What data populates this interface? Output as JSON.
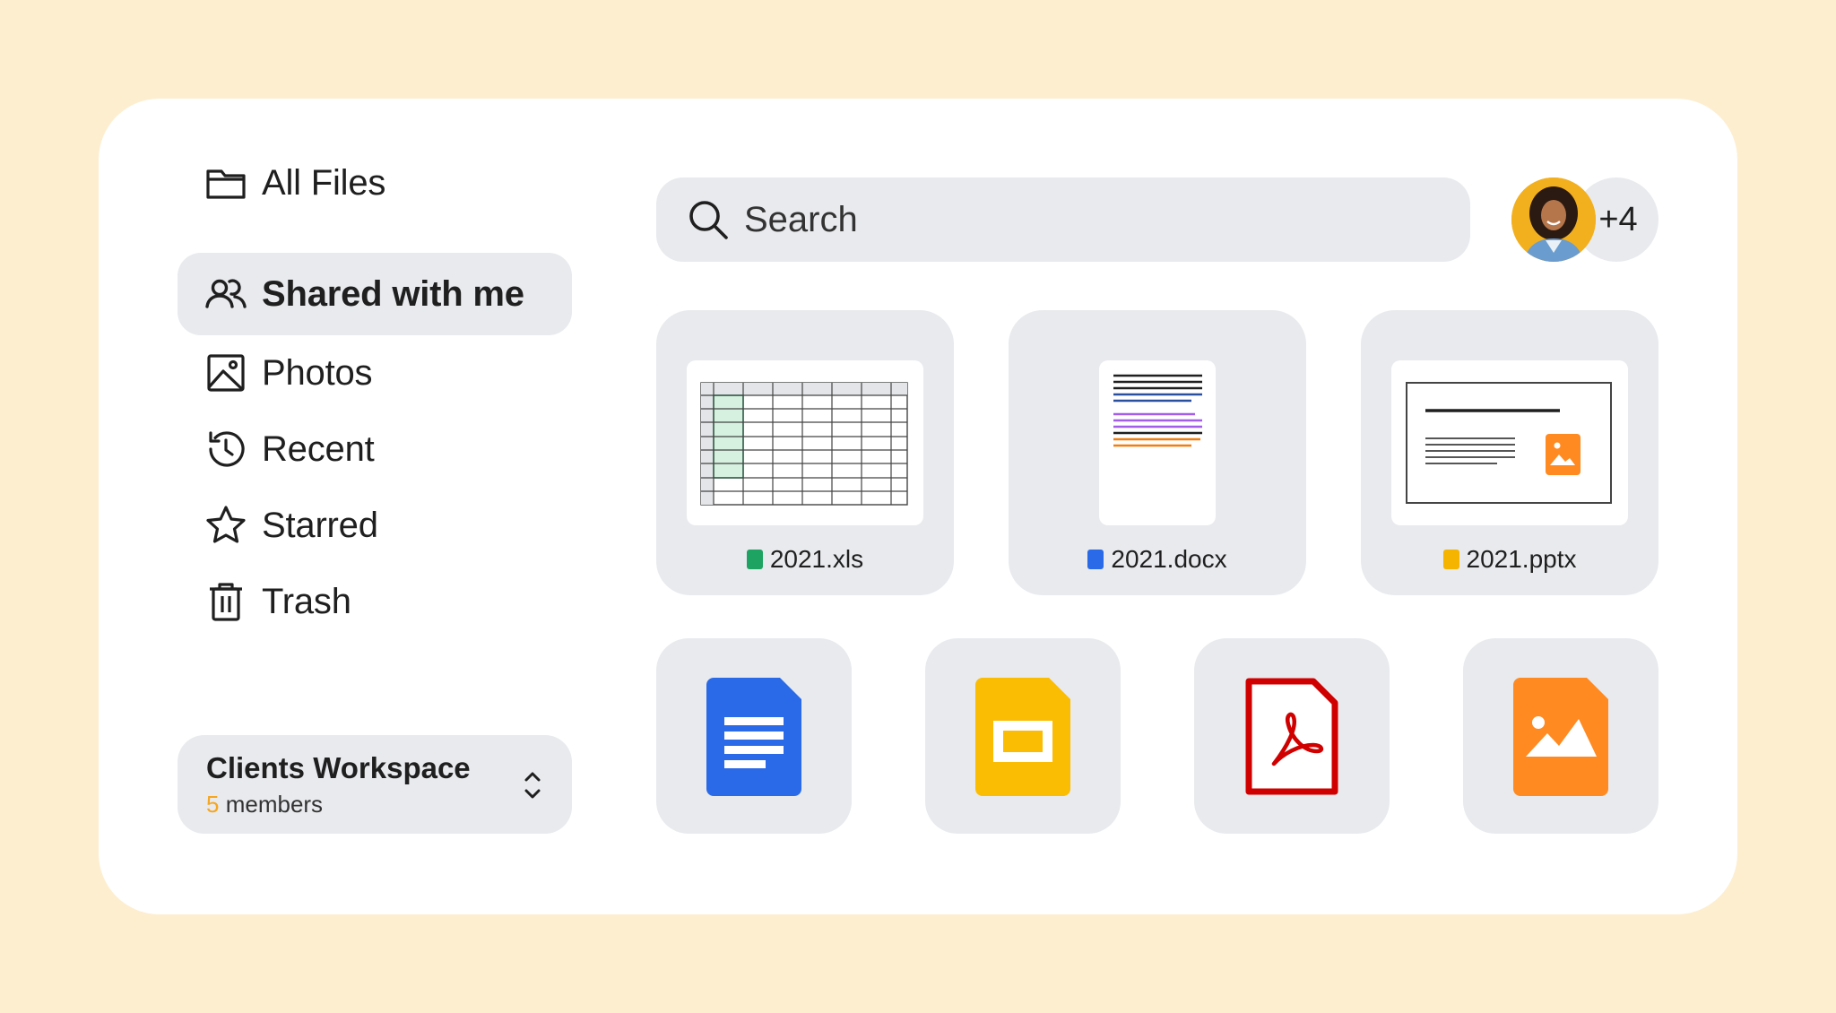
{
  "sidebar": {
    "items": [
      {
        "label": "All Files",
        "icon": "folder-icon",
        "active": false
      },
      {
        "label": "Shared with me",
        "icon": "people-icon",
        "active": true
      },
      {
        "label": "Photos",
        "icon": "image-icon",
        "active": false
      },
      {
        "label": "Recent",
        "icon": "history-icon",
        "active": false
      },
      {
        "label": "Starred",
        "icon": "star-icon",
        "active": false
      },
      {
        "label": "Trash",
        "icon": "trash-icon",
        "active": false
      }
    ],
    "workspace": {
      "name": "Clients Workspace",
      "member_count": "5",
      "member_label": "members"
    }
  },
  "search": {
    "placeholder": "Search"
  },
  "collaborators": {
    "extra_count": "+4"
  },
  "files": [
    {
      "name": "2021.xls",
      "type": "spreadsheet",
      "badge_color": "#1ea362"
    },
    {
      "name": "2021.docx",
      "type": "document",
      "badge_color": "#2a6ae8"
    },
    {
      "name": "2021.pptx",
      "type": "presentation",
      "badge_color": "#f5b400"
    }
  ],
  "file_types": [
    {
      "type": "docs",
      "icon": "google-docs-icon",
      "color": "#2a6ae8"
    },
    {
      "type": "slides",
      "icon": "google-slides-icon",
      "color": "#fbbc04"
    },
    {
      "type": "pdf",
      "icon": "pdf-icon",
      "color": "#d00000"
    },
    {
      "type": "image",
      "icon": "image-file-icon",
      "color": "#ff8a21"
    }
  ],
  "colors": {
    "background": "#fdeecf",
    "panel": "#ffffff",
    "surface": "#e8eaed",
    "accent": "#f5a623"
  }
}
